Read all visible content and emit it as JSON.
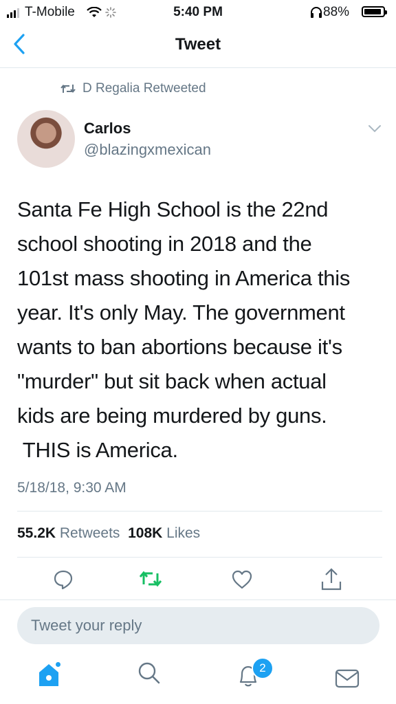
{
  "status_bar": {
    "carrier": "T-Mobile",
    "time": "5:40 PM",
    "battery": "88%"
  },
  "nav": {
    "title": "Tweet"
  },
  "retweet": {
    "label": "D Regalia Retweeted"
  },
  "author": {
    "name": "Carlos",
    "handle": "@blazingxmexican"
  },
  "tweet": {
    "lines": [
      "Santa Fe High School is the 22nd",
      "school shooting in 2018 and the",
      "101st mass shooting in America this",
      "year. It's only May. The government",
      "wants to ban abortions because it's",
      "\"murder\" but sit back when actual",
      "kids are being murdered by guns.",
      " THIS is America."
    ],
    "datetime": "5/18/18, 9:30 AM"
  },
  "stats": {
    "retweets_count": "55.2K",
    "retweets_label": "Retweets",
    "likes_count": "108K",
    "likes_label": "Likes"
  },
  "reply": {
    "placeholder": "Tweet your reply"
  },
  "tab_bar": {
    "notifications_badge": "2"
  },
  "colors": {
    "accent": "#1da1f2",
    "retweet_green": "#17bf63",
    "secondary_text": "#657786"
  }
}
